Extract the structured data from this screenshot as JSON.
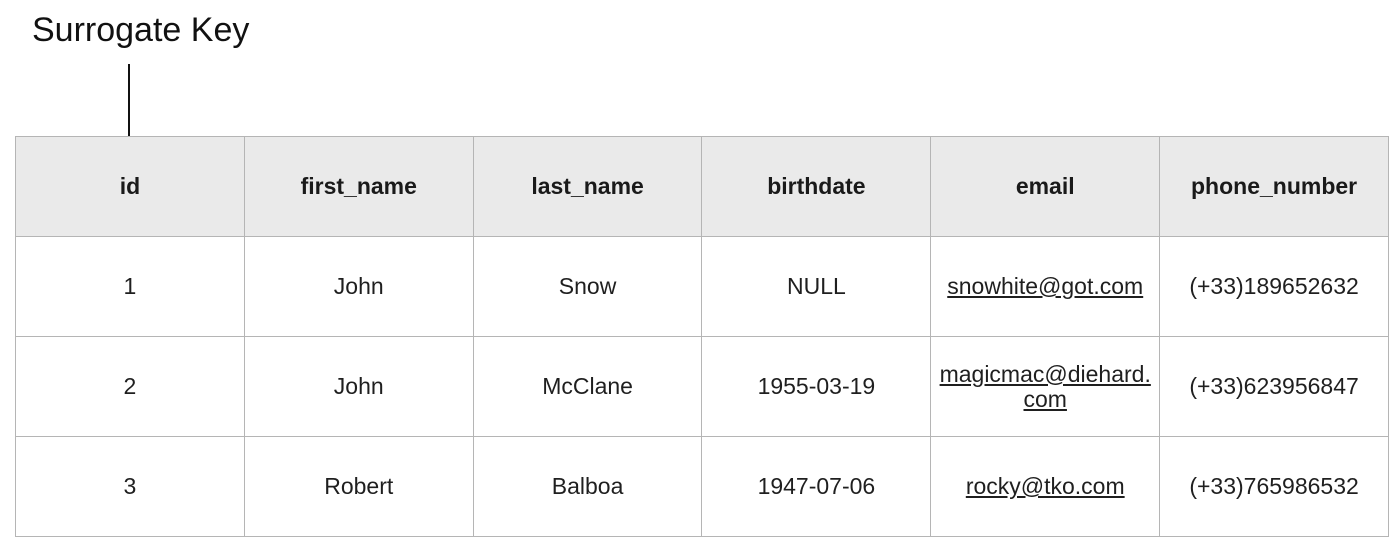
{
  "annotation": {
    "label": "Surrogate Key"
  },
  "table": {
    "columns": [
      "id",
      "first_name",
      "last_name",
      "birthdate",
      "email",
      "phone_number"
    ],
    "rows": [
      [
        "1",
        "John",
        "Snow",
        "NULL",
        "snowhite@got.com",
        "(+33)189652632"
      ],
      [
        "2",
        "John",
        "McClane",
        "1955-03-19",
        "magicmac@diehard.com",
        "(+33)623956847"
      ],
      [
        "3",
        "Robert",
        "Balboa",
        "1947-07-06",
        "rocky@tko.com",
        "(+33)765986532"
      ]
    ]
  },
  "colors": {
    "header_bg": "#eaeaea",
    "border": "#b5b5b5",
    "arrow": "#111111"
  }
}
